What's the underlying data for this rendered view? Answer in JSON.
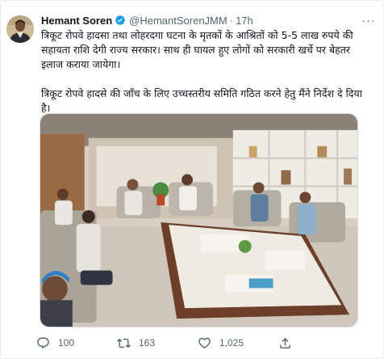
{
  "tweet": {
    "author_name": "Hemant Soren",
    "handle": "@HemantSorenJMM",
    "separator": "·",
    "time": "17h",
    "more_glyph": "···",
    "paragraphs": [
      "त्रिकूट रोपवे हादसा तथा लोहरदगा घटना के मृतकों के आश्रितों को 5-5 लाख रुपये की सहायता राशि देगी राज्य सरकार। साथ ही घायल हुए लोगों को सरकारी खर्चे पर बेहतर इलाज कराया जायेगा।",
      "त्रिकूट रोपवे हादसे की जाँच के लिए उच्चस्तरीय समिति गठित करने हेतु मैंने निर्देश दे दिया है।"
    ],
    "reply_count": "100",
    "retweet_count": "163",
    "like_count": "1,025"
  },
  "icons": {
    "verified": "verified-badge-icon",
    "reply": "reply-icon",
    "retweet": "retweet-icon",
    "like": "heart-icon",
    "share": "share-icon",
    "more": "more-icon"
  },
  "colors": {
    "verified": "#1d9bf0",
    "secondary_text": "#536471",
    "border": "#cfd9de"
  }
}
